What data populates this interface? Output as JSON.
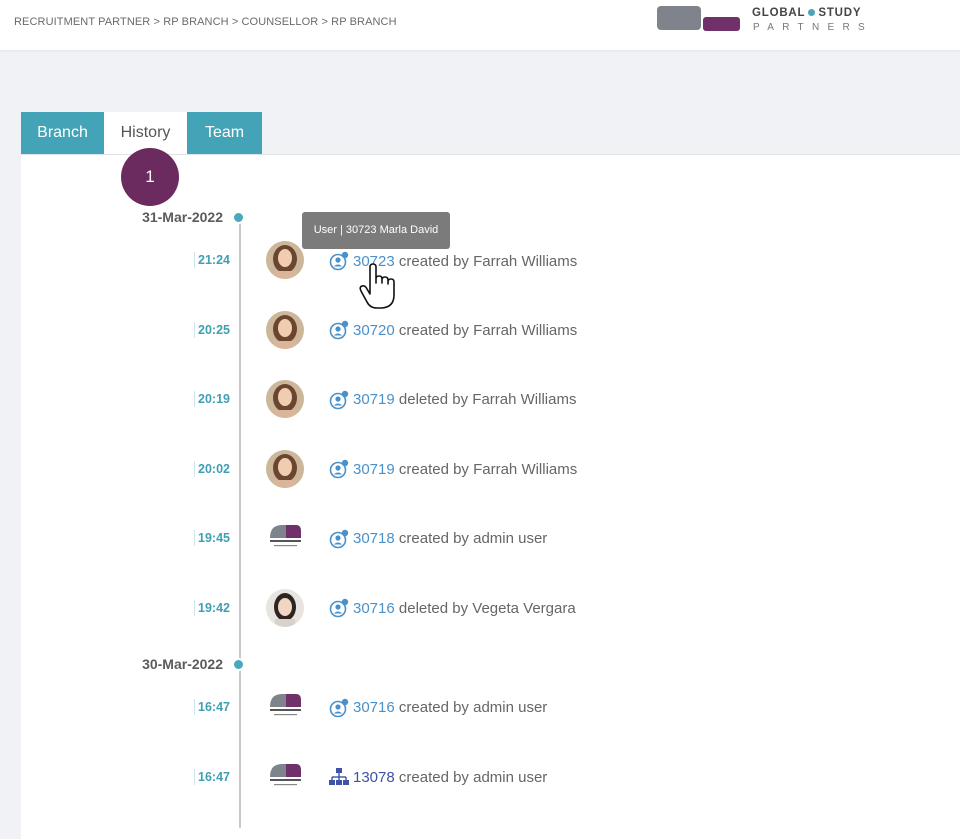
{
  "breadcrumb": "RECRUITMENT PARTNER > RP BRANCH > COUNSELLOR > RP BRANCH",
  "logo": {
    "line1_a": "GLOBAL",
    "line1_b": "STUDY",
    "line2": "PARTNERS"
  },
  "colors": {
    "accent": "#44a4b7",
    "brand_purple": "#6b2b5f",
    "link": "#4a90c9"
  },
  "tabs": [
    {
      "label": "Branch",
      "active": false
    },
    {
      "label": "History",
      "active": true
    },
    {
      "label": "Team",
      "active": false
    }
  ],
  "step_badge": "1",
  "tooltip": "User | 30723 Marla David",
  "timeline": {
    "groups": [
      {
        "date": "31-Mar-2022",
        "entries": [
          {
            "time": "21:24",
            "avatar": "farrah-photo",
            "icon": "user-icon",
            "id": "30723",
            "action": "created by Farrah Williams"
          },
          {
            "time": "20:25",
            "avatar": "farrah-photo",
            "icon": "user-icon",
            "id": "30720",
            "action": "created by Farrah Williams"
          },
          {
            "time": "20:19",
            "avatar": "farrah-photo",
            "icon": "user-icon",
            "id": "30719",
            "action": "deleted by Farrah Williams"
          },
          {
            "time": "20:02",
            "avatar": "farrah-photo",
            "icon": "user-icon",
            "id": "30719",
            "action": "created by Farrah Williams"
          },
          {
            "time": "19:45",
            "avatar": "gsp-logo",
            "icon": "user-icon",
            "id": "30718",
            "action": "created by admin user"
          },
          {
            "time": "19:42",
            "avatar": "vegeta-photo",
            "icon": "user-icon",
            "id": "30716",
            "action": "deleted by Vegeta Vergara"
          }
        ]
      },
      {
        "date": "30-Mar-2022",
        "entries": [
          {
            "time": "16:47",
            "avatar": "gsp-logo",
            "icon": "user-icon",
            "id": "30716",
            "action": "created by admin user"
          },
          {
            "time": "16:47",
            "avatar": "gsp-logo",
            "icon": "org-chart-icon",
            "id": "13078",
            "action": "created by admin user"
          }
        ]
      }
    ]
  }
}
